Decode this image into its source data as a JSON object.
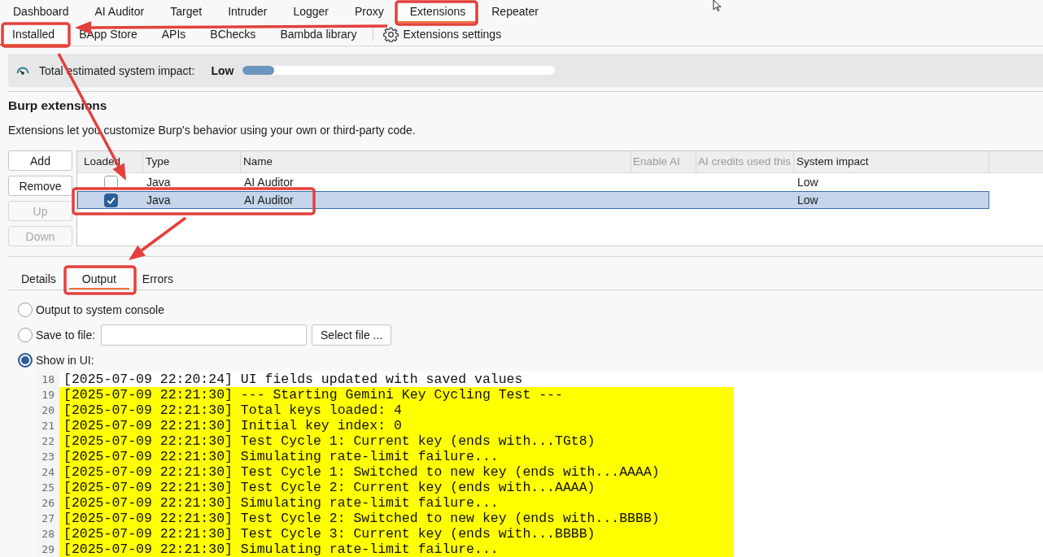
{
  "main_tabs": [
    {
      "label": "Dashboard",
      "selected": false
    },
    {
      "label": "AI Auditor",
      "selected": false
    },
    {
      "label": "Target",
      "selected": false
    },
    {
      "label": "Intruder",
      "selected": false
    },
    {
      "label": "Logger",
      "selected": false
    },
    {
      "label": "Proxy",
      "selected": false
    },
    {
      "label": "Extensions",
      "selected": true
    },
    {
      "label": "Repeater",
      "selected": false
    }
  ],
  "sub_tabs": [
    {
      "label": "Installed",
      "selected": true
    },
    {
      "label": "BApp Store",
      "selected": false
    },
    {
      "label": "APIs",
      "selected": false
    },
    {
      "label": "BChecks",
      "selected": false
    },
    {
      "label": "Bambda library",
      "selected": false
    }
  ],
  "settings_link": {
    "label": "Extensions settings"
  },
  "impact": {
    "label": "Total estimated system impact:",
    "value": "Low",
    "level": 0.1
  },
  "section": {
    "title": "Burp extensions",
    "description": "Extensions let you customize Burp's behavior using your own or third-party code."
  },
  "buttons": [
    {
      "label": "Add",
      "disabled": false
    },
    {
      "label": "Remove",
      "disabled": false
    },
    {
      "label": "Up",
      "disabled": true
    },
    {
      "label": "Down",
      "disabled": true
    }
  ],
  "table": {
    "columns": [
      {
        "label": "Loaded",
        "disabled": false
      },
      {
        "label": "Type",
        "disabled": false
      },
      {
        "label": "Name",
        "disabled": false
      },
      {
        "label": "Enable AI",
        "disabled": true
      },
      {
        "label": "AI credits used this",
        "disabled": true
      },
      {
        "label": "System impact",
        "disabled": false
      }
    ],
    "rows": [
      {
        "loaded": false,
        "type": "Java",
        "name": "AI Auditor",
        "system_impact": "Low",
        "selected": false
      },
      {
        "loaded": true,
        "type": "Java",
        "name": "AI Auditor",
        "system_impact": "Low",
        "selected": true
      }
    ]
  },
  "detail_tabs": [
    {
      "label": "Details",
      "selected": false
    },
    {
      "label": "Output",
      "selected": true
    },
    {
      "label": "Errors",
      "selected": false
    }
  ],
  "output": {
    "options": [
      {
        "label": "Output to system console",
        "selected": false
      },
      {
        "label": "Save to file:",
        "selected": false,
        "file_button": "Select file ..."
      },
      {
        "label": "Show in UI:",
        "selected": true
      }
    ]
  },
  "log": {
    "lines": [
      {
        "number": "18",
        "text": "[2025-07-09 22:20:24] UI fields updated with saved values",
        "highlighted": false
      },
      {
        "number": "19",
        "text": "[2025-07-09 22:21:30] --- Starting Gemini Key Cycling Test ---",
        "highlighted": true
      },
      {
        "number": "20",
        "text": "[2025-07-09 22:21:30] Total keys loaded: 4",
        "highlighted": true
      },
      {
        "number": "21",
        "text": "[2025-07-09 22:21:30] Initial key index: 0",
        "highlighted": true
      },
      {
        "number": "22",
        "text": "[2025-07-09 22:21:30] Test Cycle 1: Current key (ends with...TGt8)",
        "highlighted": true
      },
      {
        "number": "23",
        "text": "[2025-07-09 22:21:30] Simulating rate-limit failure...",
        "highlighted": true
      },
      {
        "number": "24",
        "text": "[2025-07-09 22:21:30] Test Cycle 1: Switched to new key (ends with...AAAA)",
        "highlighted": true
      },
      {
        "number": "25",
        "text": "[2025-07-09 22:21:30] Test Cycle 2: Current key (ends with...AAAA)",
        "highlighted": true
      },
      {
        "number": "26",
        "text": "[2025-07-09 22:21:30] Simulating rate-limit failure...",
        "highlighted": true
      },
      {
        "number": "27",
        "text": "[2025-07-09 22:21:30] Test Cycle 2: Switched to new key (ends with...BBBB)",
        "highlighted": true
      },
      {
        "number": "28",
        "text": "[2025-07-09 22:21:30] Test Cycle 3: Current key (ends with...BBBB)",
        "highlighted": true
      },
      {
        "number": "29",
        "text": "[2025-07-09 22:21:30] Simulating rate-limit failure...",
        "highlighted": true
      }
    ]
  }
}
